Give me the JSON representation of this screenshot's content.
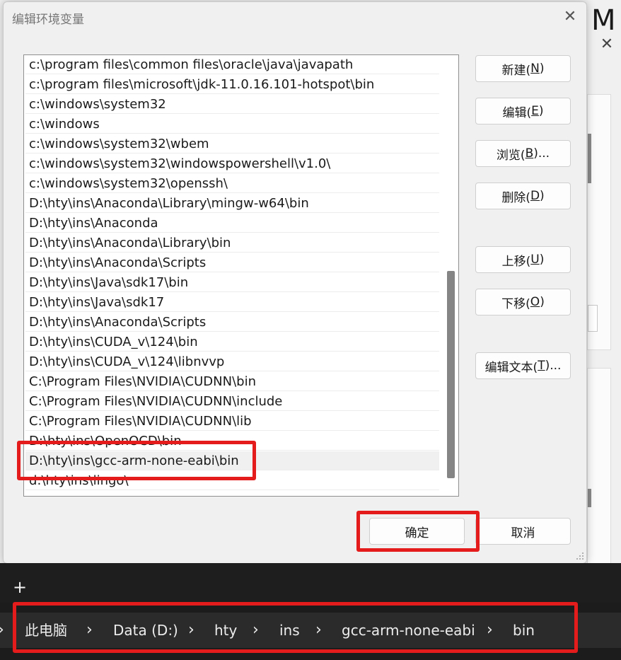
{
  "background": {
    "big_letter": "M",
    "close_glyph": "✕"
  },
  "dialog": {
    "title": "编辑环境变量",
    "close_glyph": "✕",
    "path_entries": [
      "c:\\program files\\common files\\oracle\\java\\javapath",
      "c:\\program files\\microsoft\\jdk-11.0.16.101-hotspot\\bin",
      "c:\\windows\\system32",
      "c:\\windows",
      "c:\\windows\\system32\\wbem",
      "c:\\windows\\system32\\windowspowershell\\v1.0\\",
      "c:\\windows\\system32\\openssh\\",
      "D:\\hty\\ins\\Anaconda\\Library\\mingw-w64\\bin",
      "D:\\hty\\ins\\Anaconda",
      "D:\\hty\\ins\\Anaconda\\Library\\bin",
      "D:\\hty\\ins\\Anaconda\\Scripts",
      "D:\\hty\\ins\\Java\\sdk17\\bin",
      "D:\\hty\\ins\\Java\\sdk17",
      "D:\\hty\\ins\\Anaconda\\Scripts",
      "D:\\hty\\ins\\CUDA_v\\124\\bin",
      "D:\\hty\\ins\\CUDA_v\\124\\libnvvp",
      "C:\\Program Files\\NVIDIA\\CUDNN\\bin",
      "C:\\Program Files\\NVIDIA\\CUDNN\\include",
      "C:\\Program Files\\NVIDIA\\CUDNN\\lib",
      "D:\\hty\\ins\\OpenOCD\\bin",
      "D:\\hty\\ins\\gcc-arm-none-eabi\\bin",
      "d:\\hty\\ins\\lingo\\"
    ],
    "selected_entry": "D:\\hty\\ins\\gcc-arm-none-eabi\\bin",
    "buttons": {
      "new": {
        "label": "新建(",
        "key": "N",
        "suffix": ")"
      },
      "edit": {
        "label": "编辑(",
        "key": "E",
        "suffix": ")"
      },
      "browse": {
        "label": "浏览(",
        "key": "B",
        "suffix": ")..."
      },
      "delete": {
        "label": "删除(",
        "key": "D",
        "suffix": ")"
      },
      "move_up": {
        "label": "上移(",
        "key": "U",
        "suffix": ")"
      },
      "move_down": {
        "label": "下移(",
        "key": "O",
        "suffix": ")"
      },
      "edit_text": {
        "label": "编辑文本(",
        "key": "T",
        "suffix": ")..."
      },
      "ok": "确定",
      "cancel": "取消"
    }
  },
  "explorer": {
    "new_tab_glyph": "+",
    "breadcrumb": [
      "此电脑",
      "Data (D:)",
      "hty",
      "ins",
      "gcc-arm-none-eabi",
      "bin"
    ],
    "separator": "›"
  },
  "colors": {
    "highlight_red": "#e41c1c",
    "selected_row": "#f0f0f0",
    "address_bar": "#2b2b2b"
  }
}
